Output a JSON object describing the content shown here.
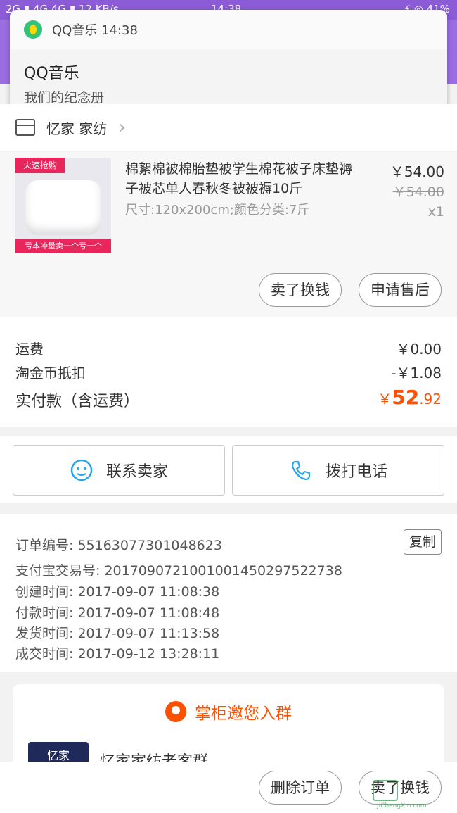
{
  "statusbar": {
    "left": "2G ▮ 4G 4G ▮ 12 KB/s",
    "time": "14:38",
    "right": "⚡ ◎ 41%"
  },
  "notification": {
    "app_name": "QQ音乐",
    "time": "14:38",
    "title": "QQ音乐",
    "text": "我们的纪念册"
  },
  "shop": {
    "name": "忆家 家纺"
  },
  "item": {
    "thumb_tag_top": "火速抢购",
    "thumb_tag_bottom": "亏本冲量卖一个亏一个",
    "title": "棉絮棉被棉胎垫被学生棉花被子床垫褥子被芯单人春秋冬被被褥10斤",
    "spec": "尺寸:120x200cm;颜色分类:7斤",
    "price": "￥54.00",
    "original_price": "￥54.00",
    "quantity": "x1",
    "buttons": {
      "sell": "卖了换钱",
      "after_sale": "申请售后"
    }
  },
  "fees": {
    "shipping_label": "运费",
    "shipping_value": "￥0.00",
    "coin_label": "淘金币抵扣",
    "coin_value": "-￥1.08",
    "total_label": "实付款（含运费）",
    "total_symbol": "￥",
    "total_int": "52",
    "total_dec": ".92"
  },
  "contact": {
    "seller": "联系卖家",
    "phone": "拨打电话"
  },
  "order_info": {
    "order_no": "订单编号: 55163077301048623",
    "copy": "复制",
    "alipay_no": "支付宝交易号: 2017090721001001450297522738",
    "created": "创建时间: 2017-09-07 11:08:38",
    "paid": "付款时间: 2017-09-07 11:08:48",
    "shipped": "发货时间: 2017-09-07 11:13:58",
    "completed": "成交时间: 2017-09-12 13:28:11"
  },
  "group": {
    "title": "掌柜邀您入群",
    "name": "忆家家纺老客群",
    "avatar_text": "忆家"
  },
  "bottom": {
    "delete": "删除订单",
    "sell": "卖了换钱"
  },
  "watermark": "JiChengXin.com",
  "colors": {
    "accent": "#ff5000",
    "nav": "#9a6ee0",
    "status": "#8b5cd6"
  }
}
